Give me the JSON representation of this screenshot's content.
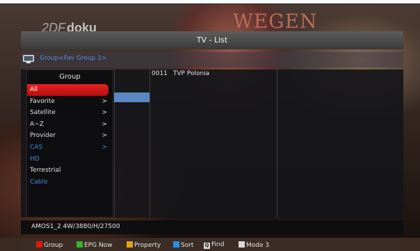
{
  "background": {
    "logo_prefix": "2DF",
    "logo_text": "doku",
    "signage_text": "WEGEN"
  },
  "window": {
    "title": "TV - List"
  },
  "breadcrumb": {
    "icon": "tv-icon",
    "text": "Group<Fav Group 1>"
  },
  "group_menu": {
    "title": "Group",
    "items": [
      {
        "label": "All",
        "arrow": "",
        "state": "selected"
      },
      {
        "label": "Favorite",
        "arrow": ">",
        "state": "normal"
      },
      {
        "label": "Satellite",
        "arrow": ">",
        "state": "normal"
      },
      {
        "label": "A~Z",
        "arrow": ">",
        "state": "normal"
      },
      {
        "label": "Provider",
        "arrow": ">",
        "state": "normal"
      },
      {
        "label": "CAS",
        "arrow": ">",
        "state": "disabled"
      },
      {
        "label": "HD",
        "arrow": "",
        "state": "disabled"
      },
      {
        "label": "Terrestrial",
        "arrow": "",
        "state": "normal"
      },
      {
        "label": "Cable",
        "arrow": "",
        "state": "disabled"
      }
    ]
  },
  "channel_list": {
    "items": [
      {
        "number": "0011",
        "name": "TVP Polonia"
      }
    ]
  },
  "info_bar": {
    "satellite": "AMOS1_2 4W/3880/H/27500"
  },
  "legend": {
    "items": [
      {
        "key": "red",
        "label": "Group",
        "color": "#e01818"
      },
      {
        "key": "green",
        "label": "EPG Now",
        "color": "#2fb82f"
      },
      {
        "key": "yellow",
        "label": "Property",
        "color": "#e0a020"
      },
      {
        "key": "blue",
        "label": "Sort",
        "color": "#2a8fe0"
      },
      {
        "key": "find",
        "label": "Find",
        "symbol": "Q",
        "color": "#d8d8d8"
      },
      {
        "key": "white",
        "label": "Mode 3",
        "color": "#d8d8d8"
      }
    ]
  }
}
